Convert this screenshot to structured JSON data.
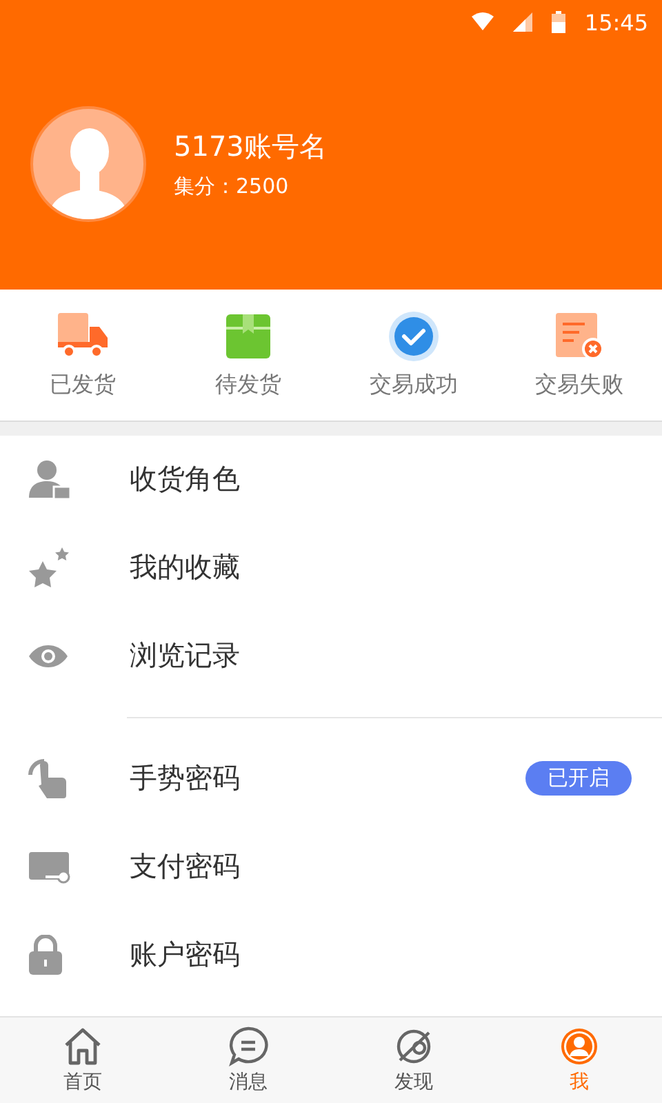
{
  "status_bar": {
    "time": "15:45"
  },
  "profile": {
    "name": "5173账号名",
    "points": "集分：2500"
  },
  "orders": [
    {
      "kind": "shipped",
      "label": "已发货"
    },
    {
      "kind": "pending",
      "label": "待发货"
    },
    {
      "kind": "success",
      "label": "交易成功"
    },
    {
      "kind": "failed",
      "label": "交易失败"
    }
  ],
  "menu_sections": [
    {
      "items": [
        {
          "kind": "role",
          "label": "收货角色"
        },
        {
          "kind": "favorite",
          "label": "我的收藏"
        },
        {
          "kind": "history",
          "label": "浏览记录"
        }
      ]
    },
    {
      "items": [
        {
          "kind": "gesture",
          "label": "手势密码",
          "badge": "已开启"
        },
        {
          "kind": "payment",
          "label": "支付密码"
        },
        {
          "kind": "lock",
          "label": "账户密码"
        }
      ]
    }
  ],
  "tab_bar": [
    {
      "kind": "home",
      "label": "首页",
      "selected": false
    },
    {
      "kind": "message",
      "label": "消息",
      "selected": false
    },
    {
      "kind": "discover",
      "label": "发现",
      "selected": false
    },
    {
      "kind": "me",
      "label": "我",
      "selected": true
    }
  ]
}
